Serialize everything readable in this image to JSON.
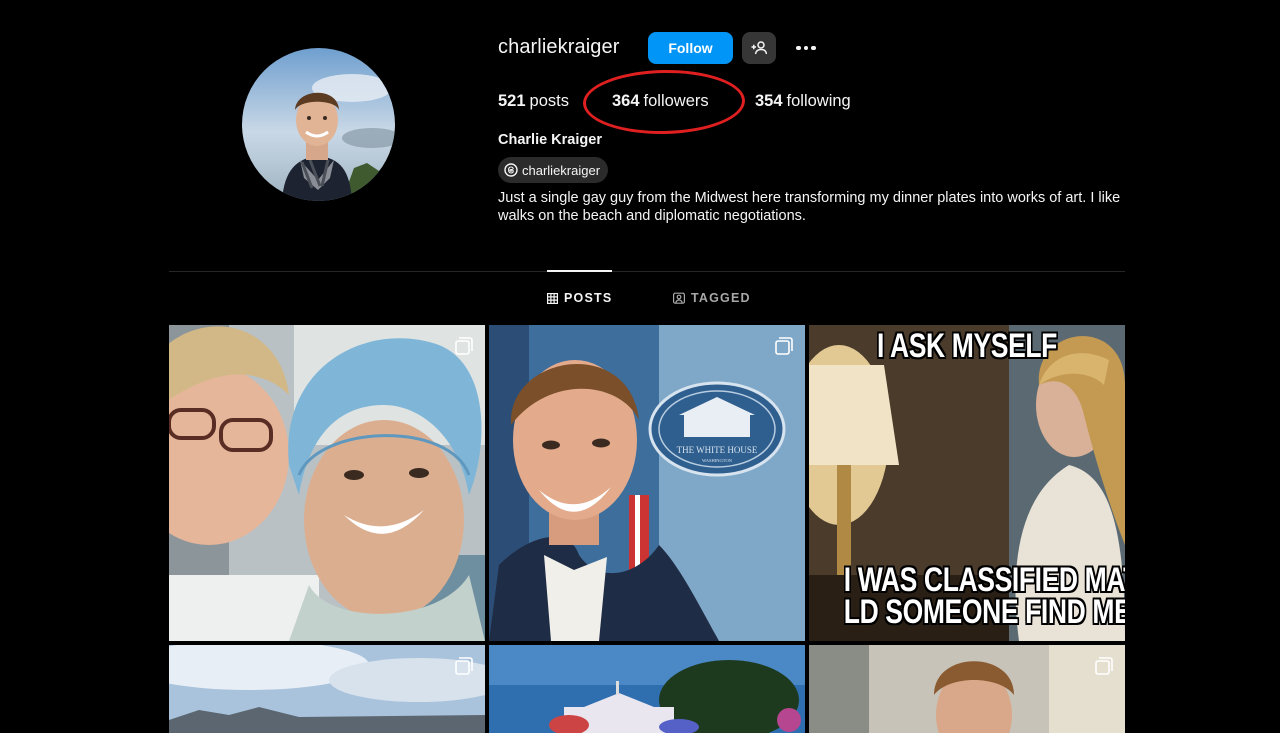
{
  "profile": {
    "username": "charliekraiger",
    "follow_label": "Follow",
    "full_name": "Charlie Kraiger",
    "threads_handle": "charliekraiger",
    "bio": "Just a single gay guy from the Midwest here transforming my dinner plates into works of art. I like walks on the beach and diplomatic negotiations."
  },
  "stats": {
    "posts_count": "521",
    "posts_label": "posts",
    "followers_count": "364",
    "followers_label": "followers",
    "following_count": "354",
    "following_label": "following"
  },
  "tabs": {
    "posts": "POSTS",
    "tagged": "TAGGED"
  },
  "posts": {
    "meme_top": "I ASK MYSELF",
    "meme_bottom_1": "I WAS CLASSIFIED MATERI",
    "meme_bottom_2": "LD SOMEONE FIND ME AT HO",
    "seal_text": "THE WHITE HOUSE",
    "seal_subtext": "WASHINGTON"
  },
  "colors": {
    "background": "#000000",
    "follow_button": "#0095f6",
    "secondary_button": "#363636",
    "annotation_circle": "#e02020"
  }
}
